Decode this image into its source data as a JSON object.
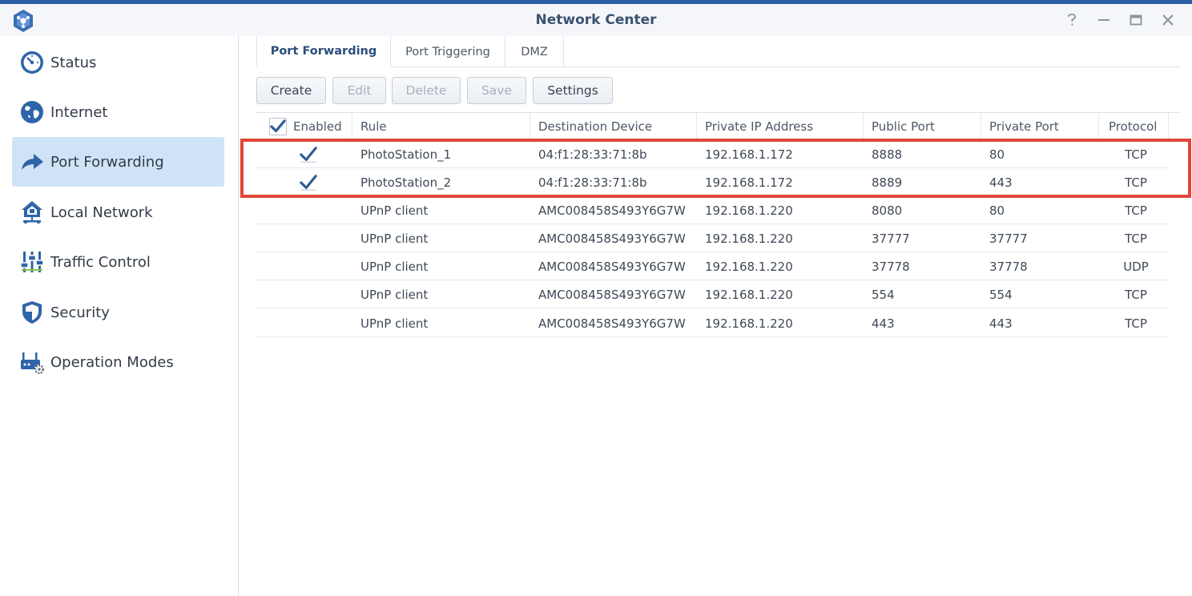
{
  "window": {
    "title": "Network Center",
    "controls": [
      "help",
      "minimize",
      "maximize",
      "close"
    ]
  },
  "sidebar": {
    "items": [
      {
        "label": "Status",
        "icon": "gauge-icon",
        "active": false
      },
      {
        "label": "Internet",
        "icon": "globe-icon",
        "active": false
      },
      {
        "label": "Port Forwarding",
        "icon": "forward-arrow-icon",
        "active": true
      },
      {
        "label": "Local Network",
        "icon": "house-network-icon",
        "active": false
      },
      {
        "label": "Traffic Control",
        "icon": "sliders-icon",
        "active": false
      },
      {
        "label": "Security",
        "icon": "shield-icon",
        "active": false
      },
      {
        "label": "Operation Modes",
        "icon": "router-gear-icon",
        "active": false
      }
    ]
  },
  "tabs": [
    {
      "label": "Port Forwarding",
      "active": true
    },
    {
      "label": "Port Triggering",
      "active": false
    },
    {
      "label": "DMZ",
      "active": false
    }
  ],
  "toolbar": {
    "create": "Create",
    "edit": "Edit",
    "delete": "Delete",
    "save": "Save",
    "settings": "Settings",
    "disabled": [
      "Edit",
      "Delete",
      "Save"
    ]
  },
  "table": {
    "columns": [
      "Enabled",
      "Rule",
      "Destination Device",
      "Private IP Address",
      "Public Port",
      "Private Port",
      "Protocol"
    ],
    "header_enabled_checked": true,
    "rows": [
      {
        "enabled": true,
        "rule": "PhotoStation_1",
        "device": "04:f1:28:33:71:8b",
        "ip": "192.168.1.172",
        "public_port": "8888",
        "private_port": "80",
        "protocol": "TCP"
      },
      {
        "enabled": true,
        "rule": "PhotoStation_2",
        "device": "04:f1:28:33:71:8b",
        "ip": "192.168.1.172",
        "public_port": "8889",
        "private_port": "443",
        "protocol": "TCP"
      },
      {
        "enabled": null,
        "rule": "UPnP client",
        "device": "AMC008458S493Y6G7W",
        "ip": "192.168.1.220",
        "public_port": "8080",
        "private_port": "80",
        "protocol": "TCP"
      },
      {
        "enabled": null,
        "rule": "UPnP client",
        "device": "AMC008458S493Y6G7W",
        "ip": "192.168.1.220",
        "public_port": "37777",
        "private_port": "37777",
        "protocol": "TCP"
      },
      {
        "enabled": null,
        "rule": "UPnP client",
        "device": "AMC008458S493Y6G7W",
        "ip": "192.168.1.220",
        "public_port": "37778",
        "private_port": "37778",
        "protocol": "UDP"
      },
      {
        "enabled": null,
        "rule": "UPnP client",
        "device": "AMC008458S493Y6G7W",
        "ip": "192.168.1.220",
        "public_port": "554",
        "private_port": "554",
        "protocol": "TCP"
      },
      {
        "enabled": null,
        "rule": "UPnP client",
        "device": "AMC008458S493Y6G7W",
        "ip": "192.168.1.220",
        "public_port": "443",
        "private_port": "443",
        "protocol": "TCP"
      }
    ]
  },
  "colors": {
    "accent": "#2d5ea8",
    "active_nav_bg": "#cfe3f7",
    "highlight_box": "#e0463a",
    "check": "#2e5c8f"
  }
}
